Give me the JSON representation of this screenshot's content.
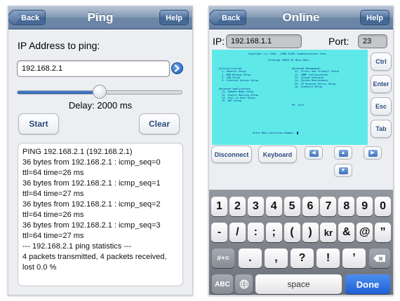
{
  "ping_screen": {
    "nav": {
      "back": "Back",
      "title": "Ping",
      "help": "Help"
    },
    "ip_label": "IP Address to ping:",
    "ip_value": "192.168.2.1",
    "delay_slider_fraction": 0.5,
    "delay_label": "Delay: 2000 ms",
    "start": "Start",
    "clear": "Clear",
    "output_lines": [
      "PING 192.168.2.1 (192.168.2.1)",
      "36 bytes from 192.168.2.1 : icmp_seq=0",
      "ttl=64 time=26 ms",
      "36 bytes from 192.168.2.1 : icmp_seq=1",
      "ttl=64 time=27 ms",
      "36 bytes from 192.168.2.1 : icmp_seq=2",
      "ttl=64 time=26 ms",
      "36 bytes from 192.168.2.1 : icmp_seq=3",
      "ttl=64 time=27 ms",
      "--- 192.168.2.1 ping statistics ---",
      "4 packets transmitted, 4 packets received,",
      "lost 0.0 %"
    ]
  },
  "online_screen": {
    "nav": {
      "back": "Back",
      "title": "Online",
      "help": "Help"
    },
    "ip_label": "IP:",
    "ip_value": "192.168.1.1",
    "port_label": "Port:",
    "port_value": "23",
    "terminal": {
      "copyright": "Copyright (c) 1994 - 2008 ZyXEL Communications Corp.",
      "menu_title": "Prestige 2602H-61 Main Menu",
      "getting_started": [
        "Getting Started",
        "1. General Setup",
        "2. WAN Backup Setup",
        "3. LAN Setup",
        "4. Internet Access Setup"
      ],
      "advanced_apps": [
        "Advanced Applications",
        "11. Remote Node Setup",
        "12. Static Routing Setup",
        "14. Dial-in User Setup",
        "15. NAT Setup"
      ],
      "advanced_mgmt": [
        "Advanced Management",
        "21. Filter and Firewall Setup",
        "22. SNMP Configuration",
        "23. System Password",
        "24. System Maintenance",
        "25. IP Routing Policy Setup",
        "26. Schedule Setup"
      ],
      "exit": "99. Exit",
      "prompt": "Enter Menu Selection Number:"
    },
    "side_buttons": [
      "Ctrl",
      "Enter",
      "Esc",
      "Tab"
    ],
    "disconnect": "Disconnect",
    "keyboard_toggle": "Keyboard",
    "keyboard": {
      "row1": [
        "1",
        "2",
        "3",
        "4",
        "5",
        "6",
        "7",
        "8",
        "9",
        "0"
      ],
      "row2": [
        "-",
        "/",
        ":",
        ";",
        "(",
        ")",
        "kr",
        "&",
        "@",
        "”"
      ],
      "row3_left": "#+=",
      "row3": [
        ".",
        ",",
        "?",
        "!",
        "’"
      ],
      "abc": "ABC",
      "space": "space",
      "done": "Done"
    }
  }
}
